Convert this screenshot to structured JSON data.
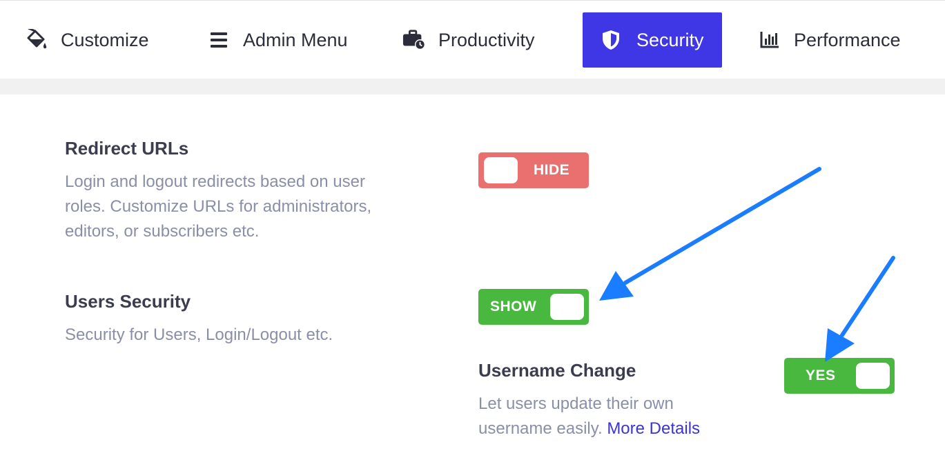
{
  "tabs": [
    {
      "label": "Customize",
      "icon": "paint-bucket-icon"
    },
    {
      "label": "Admin Menu",
      "icon": "hamburger-menu-icon"
    },
    {
      "label": "Productivity",
      "icon": "briefcase-clock-icon"
    },
    {
      "label": "Security",
      "icon": "shield-icon",
      "active": true
    },
    {
      "label": "Performance",
      "icon": "bar-chart-icon"
    }
  ],
  "settings": {
    "redirect": {
      "title": "Redirect URLs",
      "description_lines": [
        "Login and logout redirects based on user",
        "roles. Customize URLs for administrators,",
        "editors, or subscribers etc."
      ],
      "toggle_label": "HIDE",
      "toggle_on": false
    },
    "users_security": {
      "title": "Users Security",
      "description": "Security for Users, Login/Logout etc.",
      "toggle_label": "SHOW",
      "toggle_on": true
    },
    "username_change": {
      "title": "Username Change",
      "description_line1": "Let users update their own",
      "description_line2": "username easily.",
      "more_link": "More Details",
      "toggle_label": "YES",
      "toggle_on": true
    }
  },
  "colors": {
    "active_tab": "#3f36e6",
    "toggle_on": "#48b83f",
    "toggle_off": "#ea6f6f",
    "link": "#3a34d9",
    "annotation_arrow": "#1a7cff"
  }
}
